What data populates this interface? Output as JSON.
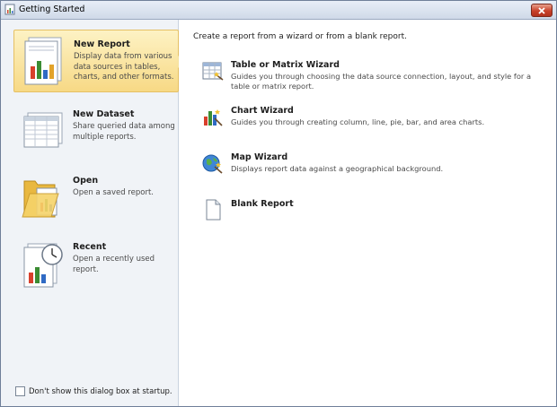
{
  "window": {
    "title": "Getting Started"
  },
  "nav": {
    "items": [
      {
        "title": "New Report",
        "desc": "Display data from various data sources in tables, charts, and other formats.",
        "selected": true,
        "icon": "new-report-icon"
      },
      {
        "title": "New Dataset",
        "desc": "Share queried data among multiple reports.",
        "icon": "new-dataset-icon"
      },
      {
        "title": "Open",
        "desc": "Open a saved report.",
        "icon": "open-folder-icon"
      },
      {
        "title": "Recent",
        "desc": "Open a recently used report.",
        "icon": "recent-clock-icon"
      }
    ],
    "dont_show_label": "Don't show this dialog box at startup.",
    "dont_show_checked": false
  },
  "main": {
    "intro": "Create a report from a wizard or from a blank report.",
    "options": [
      {
        "title": "Table or Matrix Wizard",
        "desc": "Guides you through choosing the data source connection, layout, and style for a table or matrix report.",
        "icon": "table-wizard-icon"
      },
      {
        "title": "Chart Wizard",
        "desc": "Guides you through creating column, line, pie, bar, and area charts.",
        "icon": "chart-wizard-icon"
      },
      {
        "title": "Map Wizard",
        "desc": "Displays report data against a geographical background.",
        "icon": "map-wizard-icon"
      },
      {
        "title": "Blank Report",
        "desc": "",
        "icon": "blank-report-icon"
      }
    ]
  },
  "colors": {
    "selected_bg": "#f7d985",
    "close_button": "#c8412a"
  }
}
